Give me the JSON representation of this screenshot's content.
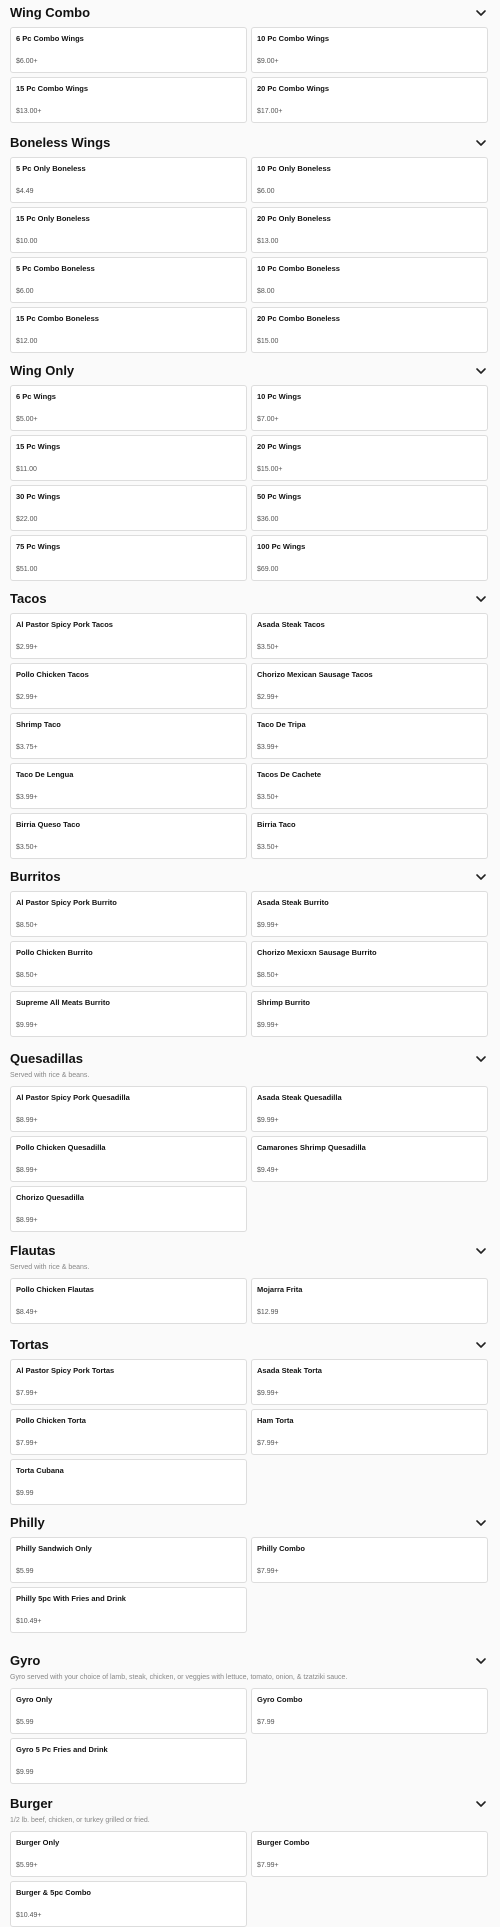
{
  "sections": [
    {
      "title": "Wing Combo",
      "description": "",
      "items": [
        {
          "name": "6 Pc Combo Wings",
          "price": "$6.00+"
        },
        {
          "name": "10 Pc Combo Wings",
          "price": "$9.00+"
        },
        {
          "name": "15 Pc Combo Wings",
          "price": "$13.00+"
        },
        {
          "name": "20 Pc Combo Wings",
          "price": "$17.00+"
        }
      ]
    },
    {
      "title": "Boneless Wings",
      "description": "",
      "items": [
        {
          "name": "5 Pc Only Boneless",
          "price": "$4.49"
        },
        {
          "name": "10 Pc Only Boneless",
          "price": "$6.00"
        },
        {
          "name": "15 Pc Only Boneless",
          "price": "$10.00"
        },
        {
          "name": "20 Pc Only Boneless",
          "price": "$13.00"
        },
        {
          "name": "5 Pc Combo Boneless",
          "price": "$6.00"
        },
        {
          "name": "10 Pc Combo Boneless",
          "price": "$8.00"
        },
        {
          "name": "15 Pc Combo Boneless",
          "price": "$12.00"
        },
        {
          "name": "20 Pc Combo Boneless",
          "price": "$15.00"
        }
      ]
    },
    {
      "title": "Wing Only",
      "description": "",
      "items": [
        {
          "name": "6 Pc Wings",
          "price": "$5.00+"
        },
        {
          "name": "10 Pc Wings",
          "price": "$7.00+"
        },
        {
          "name": "15 Pc Wings",
          "price": "$11.00"
        },
        {
          "name": "20 Pc Wings",
          "price": "$15.00+"
        },
        {
          "name": "30 Pc Wings",
          "price": "$22.00"
        },
        {
          "name": "50 Pc Wings",
          "price": "$36.00"
        },
        {
          "name": "75 Pc Wings",
          "price": "$51.00"
        },
        {
          "name": "100 Pc Wings",
          "price": "$69.00"
        }
      ]
    },
    {
      "title": "Tacos",
      "description": "",
      "items": [
        {
          "name": "Al Pastor Spicy Pork Tacos",
          "price": "$2.99+"
        },
        {
          "name": "Asada Steak Tacos",
          "price": "$3.50+"
        },
        {
          "name": "Pollo Chicken Tacos",
          "price": "$2.99+"
        },
        {
          "name": "Chorizo Mexican Sausage Tacos",
          "price": "$2.99+"
        },
        {
          "name": "Shrimp Taco",
          "price": "$3.75+"
        },
        {
          "name": "Taco De Tripa",
          "price": "$3.99+"
        },
        {
          "name": "Taco De Lengua",
          "price": "$3.99+"
        },
        {
          "name": "Tacos De Cachete",
          "price": "$3.50+"
        },
        {
          "name": "Birria Queso Taco",
          "price": "$3.50+"
        },
        {
          "name": "Birria Taco",
          "price": "$3.50+"
        }
      ]
    },
    {
      "title": "Burritos",
      "description": "",
      "items": [
        {
          "name": "Al Pastor Spicy Pork Burrito",
          "price": "$8.50+"
        },
        {
          "name": "Asada Steak Burrito",
          "price": "$9.99+"
        },
        {
          "name": "Pollo Chicken Burrito",
          "price": "$8.50+"
        },
        {
          "name": "Chorizo Mexicxn Sausage Burrito",
          "price": "$8.50+"
        },
        {
          "name": "Supreme All Meats Burrito",
          "price": "$9.99+"
        },
        {
          "name": "Shrimp Burrito",
          "price": "$9.99+"
        }
      ]
    },
    {
      "title": "Quesadillas",
      "description": "Served with rice & beans.",
      "items": [
        {
          "name": "Al Pastor Spicy Pork Quesadilla",
          "price": "$8.99+"
        },
        {
          "name": "Asada Steak Quesadilla",
          "price": "$9.99+"
        },
        {
          "name": "Pollo Chicken Quesadilla",
          "price": "$8.99+"
        },
        {
          "name": "Camarones Shrimp Quesadilla",
          "price": "$9.49+"
        },
        {
          "name": "Chorizo Quesadilla",
          "price": "$8.99+"
        }
      ]
    },
    {
      "title": "Flautas",
      "description": "Served with rice & beans.",
      "items": [
        {
          "name": "Pollo Chicken Flautas",
          "price": "$8.49+"
        },
        {
          "name": "Mojarra Frita",
          "price": "$12.99"
        }
      ]
    },
    {
      "title": "Tortas",
      "description": "",
      "items": [
        {
          "name": "Al Pastor Spicy Pork Tortas",
          "price": "$7.99+"
        },
        {
          "name": "Asada Steak Torta",
          "price": "$9.99+"
        },
        {
          "name": "Pollo Chicken Torta",
          "price": "$7.99+"
        },
        {
          "name": "Ham Torta",
          "price": "$7.99+"
        },
        {
          "name": "Torta Cubana",
          "price": "$9.99"
        }
      ]
    },
    {
      "title": "Philly",
      "description": "",
      "items": [
        {
          "name": "Philly Sandwich Only",
          "price": "$5.99"
        },
        {
          "name": "Philly Combo",
          "price": "$7.99+"
        },
        {
          "name": "Philly 5pc With Fries and Drink",
          "price": "$10.49+"
        }
      ]
    },
    {
      "title": "Gyro",
      "description": "Gyro served with your choice of lamb, steak, chicken, or veggies with lettuce, tomato, onion, & tzatziki sauce.",
      "items": [
        {
          "name": "Gyro Only",
          "price": "$5.99"
        },
        {
          "name": "Gyro Combo",
          "price": "$7.99"
        },
        {
          "name": "Gyro 5 Pc Fries and Drink",
          "price": "$9.99"
        }
      ]
    },
    {
      "title": "Burger",
      "description": "1/2 lb. beef, chicken, or turkey grilled or fried.",
      "items": [
        {
          "name": "Burger Only",
          "price": "$5.99+"
        },
        {
          "name": "Burger Combo",
          "price": "$7.99+"
        },
        {
          "name": "Burger & 5pc Combo",
          "price": "$10.49+"
        }
      ]
    }
  ]
}
